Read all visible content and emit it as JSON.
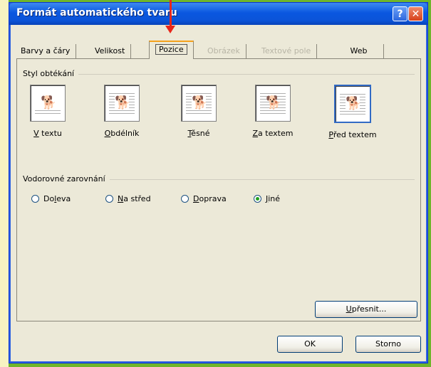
{
  "window": {
    "title": "Formát automatického tvaru"
  },
  "titlebar_buttons": {
    "help": "?",
    "close": "✕"
  },
  "tabs": [
    {
      "label": "Barvy a čáry",
      "state": "normal"
    },
    {
      "label": "Velikost",
      "state": "normal"
    },
    {
      "label": "Pozice",
      "state": "active"
    },
    {
      "label": "Obrázek",
      "state": "disabled"
    },
    {
      "label": "Textové pole",
      "state": "disabled"
    },
    {
      "label": "Web",
      "state": "normal"
    }
  ],
  "wrapping": {
    "group_label": "Styl obtékání",
    "options": [
      {
        "key": "V",
        "rest": " textu",
        "icon": "dog-inline-icon"
      },
      {
        "key": "O",
        "rest": "bdélník",
        "icon": "dog-square-icon"
      },
      {
        "key": "T",
        "rest": "ěsné",
        "icon": "dog-tight-icon"
      },
      {
        "key": "Z",
        "rest": "a textem",
        "icon": "dog-behind-text-icon"
      },
      {
        "key": "P",
        "rest": "řed textem",
        "icon": "dog-in-front-icon",
        "selected": true
      }
    ]
  },
  "alignment": {
    "group_label": "Vodorovné zarovnání",
    "options": [
      {
        "pre": "Do",
        "key": "l",
        "post": "eva",
        "checked": false
      },
      {
        "pre": "",
        "key": "N",
        "post": "a střed",
        "checked": false
      },
      {
        "pre": "",
        "key": "D",
        "post": "oprava",
        "checked": false
      },
      {
        "pre": "",
        "key": "J",
        "post": "iné",
        "checked": true
      }
    ]
  },
  "buttons": {
    "advanced": {
      "key": "U",
      "rest": "přesnit..."
    },
    "ok": "OK",
    "cancel": "Storno"
  },
  "colors": {
    "accent": "#0a57e0",
    "annotation_arrow": "#e8261a",
    "dialog_bg": "#ece9d8"
  }
}
